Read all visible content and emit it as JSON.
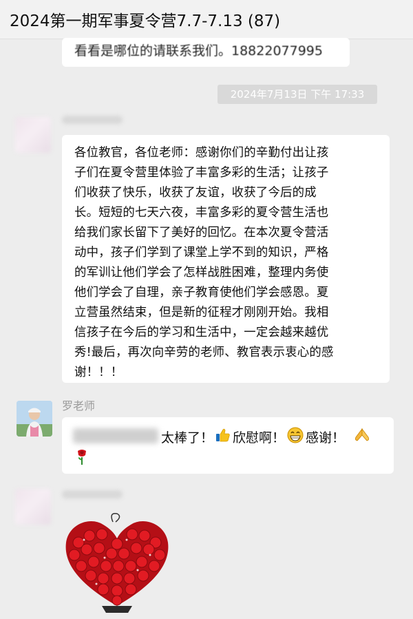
{
  "header": {
    "title": "2024第一期军事夏令营7.7-7.13 (87)"
  },
  "messages": {
    "partial": {
      "text": "看看是哪位的请联系我们。18822077995"
    },
    "timestamp": "2024年7月13日 下午 17:33",
    "long": {
      "text": "各位教官，各位老师：感谢你们的辛勤付出让孩\n子们在夏令营里体验了丰富多彩的生活；让孩子\n们收获了快乐，收获了友谊，收获了今后的成\n长。短短的七天六夜，丰富多彩的夏令营生活也\n给我们家长留下了美好的回忆。在本次夏令营活\n动中，孩子们学到了课堂上学不到的知识，严格\n的军训让他们学会了怎样战胜困难，整理内务使\n他们学会了自理，亲子教育使他们学会感恩。夏\n立营虽然结束，但是新的征程才刚刚开始。我相\n信孩子在今后的学习和生活中，一定会越来越优\n秀!最后，再次向辛劳的老师、教官表示衷心的感\n谢！！！"
    },
    "reply": {
      "sender": "罗老师",
      "text1": "太棒了！",
      "text2": "欣慰啊！",
      "text3": "感谢！"
    }
  },
  "icons": {
    "thumbs_up": "thumbs-up-icon",
    "grin": "grin-icon",
    "pray": "pray-icon",
    "rose": "rose-icon"
  },
  "colors": {
    "background": "#ededed",
    "bubble": "#ffffff",
    "timestamp_bg": "#d9d9d9",
    "rose_red": "#d2141c"
  }
}
